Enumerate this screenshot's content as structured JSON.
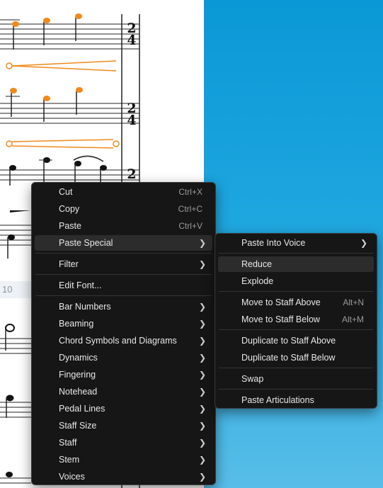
{
  "score": {
    "measure_number": "10",
    "time_signature": "2/4"
  },
  "context_menu": {
    "items": [
      {
        "label": "Cut",
        "shortcut": "Ctrl+X"
      },
      {
        "label": "Copy",
        "shortcut": "Ctrl+C"
      },
      {
        "label": "Paste",
        "shortcut": "Ctrl+V"
      },
      {
        "label": "Paste Special"
      },
      {
        "label": "Filter"
      },
      {
        "label": "Edit Font..."
      },
      {
        "label": "Bar Numbers"
      },
      {
        "label": "Beaming"
      },
      {
        "label": "Chord Symbols and Diagrams"
      },
      {
        "label": "Dynamics"
      },
      {
        "label": "Fingering"
      },
      {
        "label": "Notehead"
      },
      {
        "label": "Pedal Lines"
      },
      {
        "label": "Staff Size"
      },
      {
        "label": "Staff"
      },
      {
        "label": "Stem"
      },
      {
        "label": "Voices"
      }
    ]
  },
  "submenu": {
    "items": [
      {
        "label": "Paste Into Voice"
      },
      {
        "label": "Reduce"
      },
      {
        "label": "Explode"
      },
      {
        "label": "Move to Staff Above",
        "shortcut": "Alt+N"
      },
      {
        "label": "Move to Staff Below",
        "shortcut": "Alt+M"
      },
      {
        "label": "Duplicate to Staff Above"
      },
      {
        "label": "Duplicate to Staff Below"
      },
      {
        "label": "Swap"
      },
      {
        "label": "Paste Articulations"
      }
    ]
  },
  "colors": {
    "menu_bg": "#161616",
    "highlight": "#2c2c2c",
    "selection_orange": "#f08a1c",
    "desktop_blue": "#1ea6df"
  }
}
